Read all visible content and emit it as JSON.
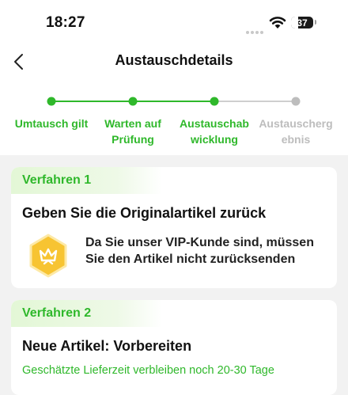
{
  "status_bar": {
    "time": "18:27",
    "battery": "37"
  },
  "nav": {
    "title": "Austauschdetails"
  },
  "steps": [
    {
      "line1": "Umtausch gilt",
      "line2": "",
      "state": "done"
    },
    {
      "line1": "Warten auf",
      "line2": "Prüfung",
      "state": "done"
    },
    {
      "line1": "Austauschab",
      "line2": "wicklung",
      "state": "done"
    },
    {
      "line1": "Austauscherg",
      "line2": "ebnis",
      "state": "pending"
    }
  ],
  "card1": {
    "tag": "Verfahren 1",
    "title": "Geben Sie die Originalartikel zurück",
    "vip_line1": "Da Sie unser VIP-Kunde sind, müssen",
    "vip_line2": "Sie den Artikel nicht zurücksenden"
  },
  "card2": {
    "tag": "Verfahren 2",
    "title": "Neue Artikel: Vorbereiten",
    "delivery": "Geschätzte Lieferzeit verbleiben noch 20-30 Tage"
  },
  "colors": {
    "accent": "#2fb82b",
    "pending": "#bdbdbd",
    "vip_gold": "#f7c432"
  }
}
